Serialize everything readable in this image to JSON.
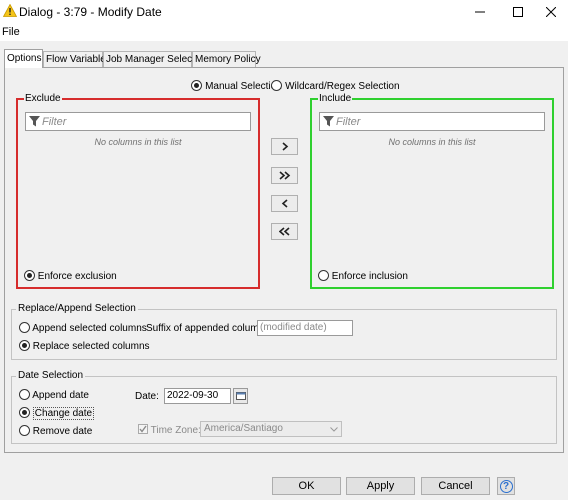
{
  "window": {
    "title": "Dialog - 3:79 - Modify Date",
    "icon": "warning-triangle-icon",
    "controls": [
      "minimize-icon",
      "maximize-icon",
      "close-icon"
    ]
  },
  "menu": {
    "file": "File"
  },
  "tabs": [
    {
      "label": "Options",
      "active": true
    },
    {
      "label": "Flow Variables",
      "active": false
    },
    {
      "label": "Job Manager Selection",
      "active": false
    },
    {
      "label": "Memory Policy",
      "active": false
    }
  ],
  "column_filter": {
    "mode_manual": "Manual Selection",
    "mode_wildcard": "Wildcard/Regex Selection",
    "selected_mode": "manual",
    "exclude": {
      "title": "Exclude",
      "filter_placeholder": "Filter",
      "empty_text": "No columns in this list",
      "enforce_label": "Enforce exclusion",
      "enforce_selected": true
    },
    "include": {
      "title": "Include",
      "filter_placeholder": "Filter",
      "empty_text": "No columns in this list",
      "enforce_label": "Enforce inclusion",
      "enforce_selected": false
    },
    "buttons": [
      ">",
      ">>",
      "<",
      "<<"
    ]
  },
  "replace_append": {
    "title": "Replace/Append Selection",
    "append_label": "Append selected columns",
    "replace_label": "Replace selected columns",
    "selected": "replace",
    "suffix_label": "Suffix of appended columns:",
    "suffix_value": "(modified date)"
  },
  "date_selection": {
    "title": "Date Selection",
    "append_label": "Append date",
    "change_label": "Change date",
    "remove_label": "Remove date",
    "selected": "change",
    "date_label": "Date:",
    "date_value": "2022-09-30",
    "timezone_label": "Time Zone:",
    "timezone_checked": true,
    "timezone_value": "America/Santiago"
  },
  "footer": {
    "ok": "OK",
    "apply": "Apply",
    "cancel": "Cancel",
    "help": "?"
  },
  "colors": {
    "exclude_border": "#d62c2c",
    "include_border": "#2fd02f",
    "title_icon": "#f5c518"
  }
}
